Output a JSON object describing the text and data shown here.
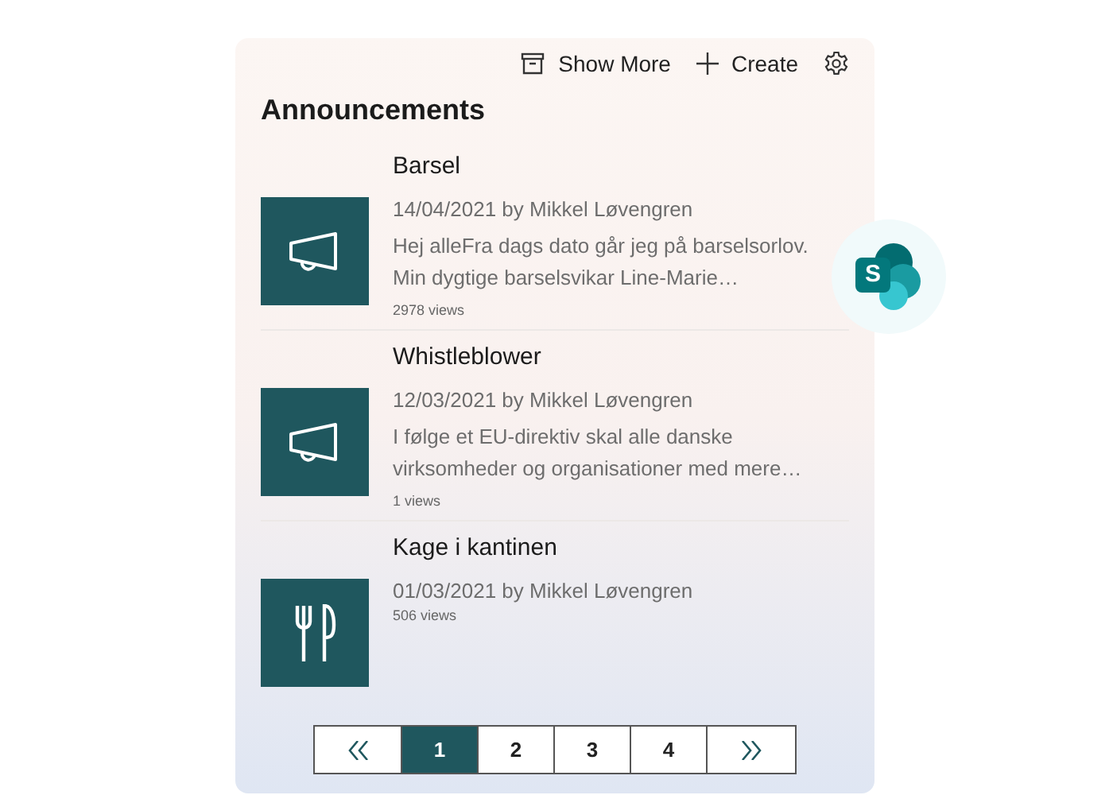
{
  "toolbar": [
    {
      "kind": "archive",
      "label": "Show More"
    },
    {
      "kind": "plus",
      "label": "Create"
    },
    {
      "kind": "gear"
    }
  ],
  "title": "Announcements",
  "items": [
    {
      "kind": "megaphone",
      "title": "Barsel",
      "meta": "14/04/2021 by Mikkel Løvengren",
      "excerpt": "Hej alleFra dags dato går jeg på barselsorlov. Min dygtige barselsvikar Line-Marie…",
      "views": "2978 views"
    },
    {
      "kind": "megaphone",
      "title": "Whistleblower",
      "meta": "12/03/2021 by Mikkel Løvengren",
      "excerpt": "I følge et EU-direktiv skal alle danske virksomheder og organisationer med mere…",
      "views": "1 views"
    },
    {
      "kind": "cutlery",
      "title": "Kage i kantinen",
      "meta": "01/03/2021 by Mikkel Løvengren",
      "views": "506 views"
    }
  ],
  "pager": [
    {
      "label": "1",
      "selected": true
    },
    {
      "label": "2",
      "selected": false
    },
    {
      "label": "3",
      "selected": false
    },
    {
      "label": "4",
      "selected": false
    }
  ],
  "app_badge": {
    "letter": "S"
  }
}
